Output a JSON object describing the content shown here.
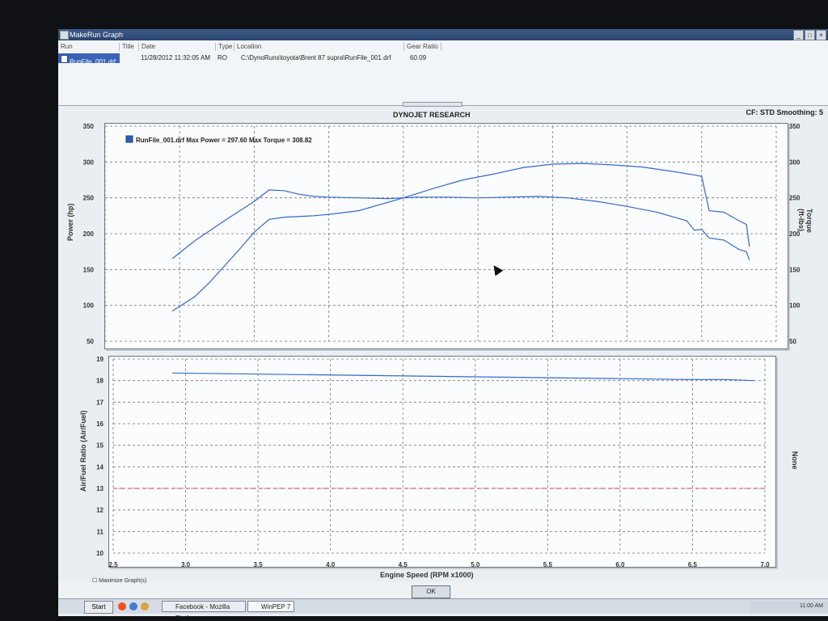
{
  "window": {
    "title": "MakeRun Graph"
  },
  "header": {
    "columns": [
      "Run",
      "Title",
      "Date",
      "Type",
      "Location",
      "Gear Ratio"
    ],
    "row": {
      "run": "RunFile_001.drf",
      "title": "",
      "date": "11/28/2012 11:32:05 AM",
      "type": "RO",
      "location": "C:\\DynoRuns\\toyota\\Brent 87 supra\\RunFile_001.drf",
      "gear_ratio": "60.09"
    }
  },
  "graph": {
    "title": "DYNOJET RESEARCH",
    "cf": "CF: STD  Smoothing: 5",
    "legend": "RunFile_001.drf Max Power = 297.60 Max Torque = 308.82",
    "upper_left_label": "Power (hp)",
    "upper_right_label": "Torque (ft-lbs)",
    "lower_left_label": "Air/Fuel Ratio (Air/Fuel)",
    "lower_right_label": "None",
    "x_label": "Engine Speed (RPM x1000)",
    "x_ticks": [
      "2.5",
      "3.0",
      "3.5",
      "4.0",
      "4.5",
      "5.0",
      "5.5",
      "6.0",
      "6.5",
      "7.0"
    ],
    "upper_left_ticks": [
      "350",
      "300",
      "250",
      "200",
      "150",
      "100",
      "50"
    ],
    "upper_right_ticks": [
      "350",
      "300",
      "250",
      "200",
      "150",
      "100",
      "50"
    ],
    "lower_ticks": [
      "19",
      "18",
      "17",
      "16",
      "15",
      "14",
      "13",
      "12",
      "11",
      "10"
    ]
  },
  "chart_data": [
    {
      "type": "line",
      "title": "RunFile_001.drf Max Power = 297.60 Max Torque = 308.82",
      "xlabel": "Engine Speed (RPM x1000)",
      "ylabel": "Power (hp)",
      "xlim": [
        2.5,
        7.0
      ],
      "ylim": [
        50,
        350
      ],
      "series": [
        {
          "name": "Power",
          "x": [
            2.95,
            3.1,
            3.2,
            3.3,
            3.4,
            3.5,
            3.6,
            3.7,
            3.9,
            4.0,
            4.2,
            4.5,
            4.7,
            4.9,
            5.1,
            5.3,
            5.5,
            5.7,
            5.9,
            6.1,
            6.3,
            6.45,
            6.5,
            6.55,
            6.65,
            6.75,
            6.8,
            6.82
          ],
          "y": [
            92,
            112,
            132,
            155,
            178,
            202,
            220,
            223,
            225,
            227,
            232,
            250,
            263,
            275,
            283,
            292,
            297,
            298,
            296,
            293,
            287,
            282,
            280,
            232,
            230,
            218,
            213,
            182
          ]
        },
        {
          "name": "Torque",
          "x": [
            2.95,
            3.1,
            3.3,
            3.5,
            3.6,
            3.7,
            3.8,
            3.9,
            4.0,
            4.2,
            4.4,
            4.6,
            4.8,
            5.0,
            5.2,
            5.4,
            5.6,
            5.8,
            6.0,
            6.2,
            6.4,
            6.45,
            6.5,
            6.55,
            6.65,
            6.75,
            6.8,
            6.82
          ],
          "y": [
            165,
            190,
            218,
            245,
            261,
            260,
            255,
            252,
            251,
            250,
            249,
            251,
            251,
            250,
            251,
            252,
            250,
            245,
            238,
            230,
            218,
            205,
            206,
            194,
            191,
            178,
            175,
            163
          ]
        },
        {
          "name": "Air/Fuel",
          "x": [
            2.95,
            6.4,
            6.65,
            6.85
          ],
          "y": [
            18.35,
            18.05,
            18.05,
            18.0
          ]
        }
      ],
      "grid": true
    }
  ],
  "bottom": {
    "maximize_label": "Maximize Graph(s)",
    "ok_label": "OK"
  },
  "taskbar": {
    "start": "Start",
    "items": [
      "Facebook - Mozilla Firefox",
      "WinPEP 7"
    ],
    "time": "11:00 AM"
  }
}
